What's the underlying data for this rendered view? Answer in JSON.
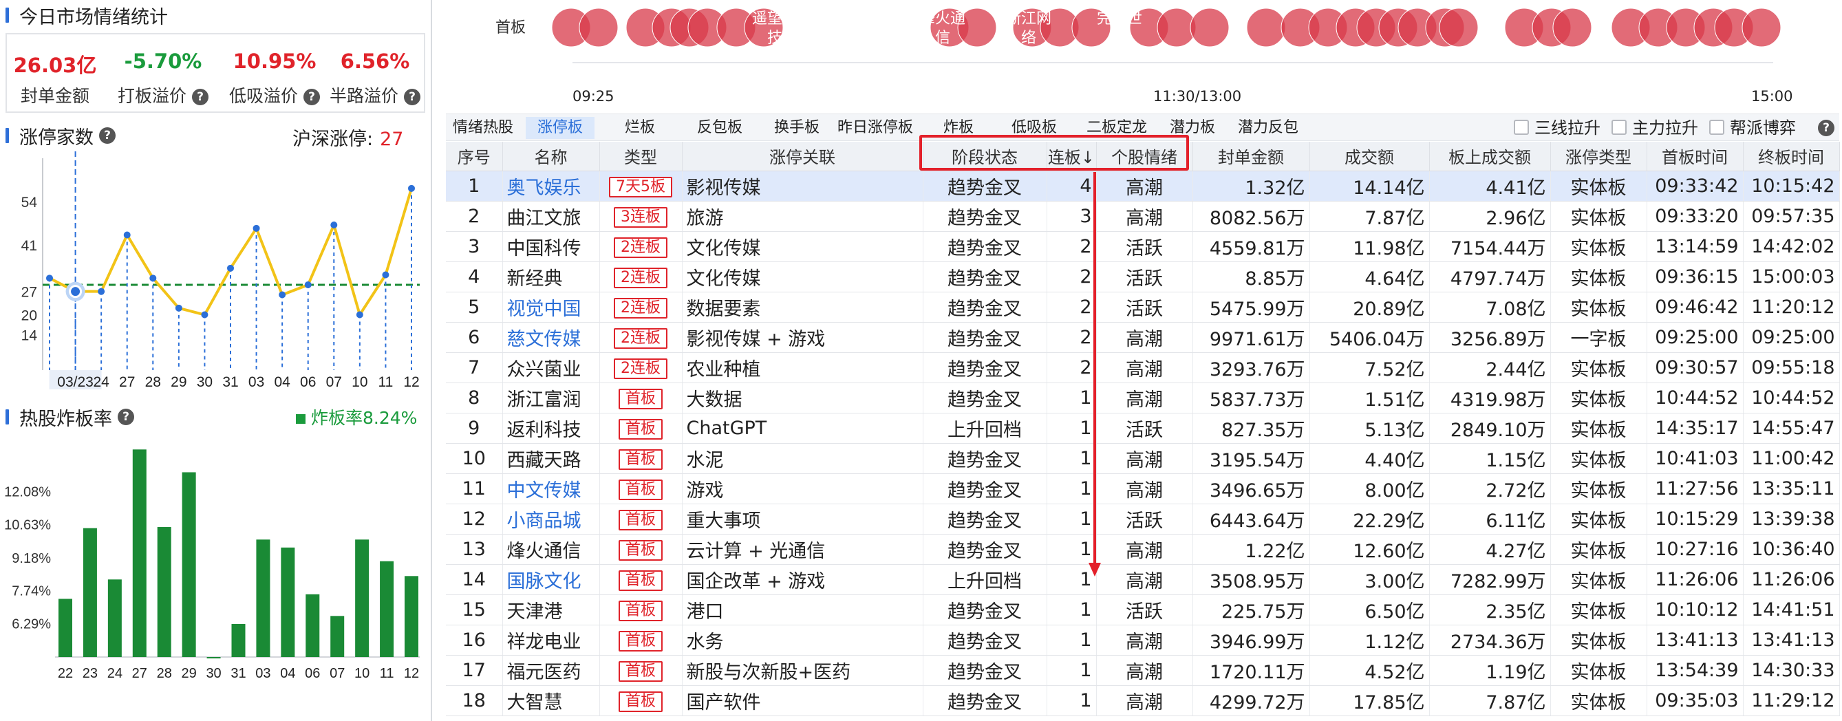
{
  "left": {
    "summary_title": "今日市场情绪统计",
    "stats": [
      {
        "value": "26.03亿",
        "label": "封单金额",
        "color": "red",
        "help": false
      },
      {
        "value": "-5.70%",
        "label": "打板溢价",
        "color": "green",
        "help": true
      },
      {
        "value": "10.95%",
        "label": "低吸溢价",
        "color": "red",
        "help": true
      },
      {
        "value": "6.56%",
        "label": "半路溢价",
        "color": "red",
        "help": true
      }
    ],
    "zt_title": "涨停家数",
    "zt_count_label": "沪深涨停:",
    "zt_count_value": "27",
    "zbl_title": "热股炸板率",
    "zbl_legend": "炸板率8.24%"
  },
  "chart_data": [
    {
      "type": "line",
      "categories": [
        "",
        "03/23",
        "24",
        "27",
        "28",
        "29",
        "30",
        "31",
        "03",
        "04",
        "06",
        "07",
        "10",
        "11",
        "12"
      ],
      "values": [
        31,
        27,
        27,
        44,
        31,
        22,
        20,
        34,
        46,
        26,
        29,
        47,
        20,
        32,
        58
      ],
      "reference_line": 29,
      "highlight_index": 1,
      "yticks": [
        14,
        20,
        27,
        41,
        54
      ],
      "ylim": [
        5,
        65
      ],
      "grid": false,
      "colors": {
        "line": "#f2c317",
        "ref": "#1a8a35",
        "drop": "#2b6fd8"
      }
    },
    {
      "type": "bar",
      "categories": [
        "22",
        "23",
        "24",
        "27",
        "28",
        "29",
        "30",
        "31",
        "03",
        "04",
        "06",
        "07",
        "10",
        "11",
        "12"
      ],
      "values": [
        7.35,
        10.45,
        8.2,
        13.9,
        10.5,
        12.9,
        4.8,
        6.25,
        9.95,
        9.6,
        7.55,
        6.6,
        9.95,
        9.0,
        8.35
      ],
      "yticks": [
        "12.08%",
        "10.63%",
        "9.18%",
        "7.74%",
        "6.29%"
      ],
      "ytick_values": [
        12.08,
        10.63,
        9.18,
        7.74,
        6.29
      ],
      "ylim": [
        4.8,
        14.0
      ],
      "color": "#1a8a35"
    }
  ],
  "timeline": {
    "label": "首板",
    "times": [
      "09:25",
      "11:30/13:00",
      "15:00"
    ],
    "bubble_names": [
      "遥望科技",
      "烽火通信",
      "浙江网络",
      "完美世界"
    ]
  },
  "tabs": [
    "情绪热股",
    "涨停板",
    "烂板",
    "反包板",
    "换手板",
    "昨日涨停板",
    "炸板",
    "低吸板",
    "二板定龙",
    "潜力板",
    "潜力反包"
  ],
  "active_tab": 1,
  "checkboxes": [
    "三线拉升",
    "主力拉升",
    "帮派博弈"
  ],
  "table": {
    "headers": [
      "序号",
      "名称",
      "类型",
      "涨停关联",
      "阶段状态",
      "连板↓",
      "个股情绪",
      "封单金额",
      "成交额",
      "板上成交额",
      "涨停类型",
      "首板时间",
      "终板时间"
    ],
    "rows": [
      [
        "1",
        "奥飞娱乐",
        "7天5板",
        "影视传媒",
        "趋势金叉",
        "4",
        "高潮",
        "1.32亿",
        "14.14亿",
        "4.41亿",
        "实体板",
        "09:33:42",
        "10:15:42"
      ],
      [
        "2",
        "曲江文旅",
        "3连板",
        "旅游",
        "趋势金叉",
        "3",
        "高潮",
        "8082.56万",
        "7.87亿",
        "2.96亿",
        "实体板",
        "09:33:20",
        "09:57:35"
      ],
      [
        "3",
        "中国科传",
        "2连板",
        "文化传媒",
        "趋势金叉",
        "2",
        "活跃",
        "4559.81万",
        "11.98亿",
        "7154.44万",
        "实体板",
        "13:14:59",
        "14:42:02"
      ],
      [
        "4",
        "新经典",
        "2连板",
        "文化传媒",
        "趋势金叉",
        "2",
        "活跃",
        "8.85万",
        "4.64亿",
        "4797.74万",
        "实体板",
        "09:36:15",
        "15:00:03"
      ],
      [
        "5",
        "视觉中国",
        "2连板",
        "数据要素",
        "趋势金叉",
        "2",
        "活跃",
        "5475.99万",
        "20.89亿",
        "7.08亿",
        "实体板",
        "09:46:42",
        "11:20:12"
      ],
      [
        "6",
        "慈文传媒",
        "2连板",
        "影视传媒 + 游戏",
        "趋势金叉",
        "2",
        "高潮",
        "9971.61万",
        "5406.04万",
        "3256.89万",
        "一字板",
        "09:25:00",
        "09:25:00"
      ],
      [
        "7",
        "众兴菌业",
        "2连板",
        "农业种植",
        "趋势金叉",
        "2",
        "高潮",
        "3293.76万",
        "7.52亿",
        "2.44亿",
        "实体板",
        "09:30:57",
        "09:55:18"
      ],
      [
        "8",
        "浙江富润",
        "首板",
        "大数据",
        "趋势金叉",
        "1",
        "高潮",
        "5837.73万",
        "1.51亿",
        "4319.98万",
        "实体板",
        "10:44:52",
        "10:44:52"
      ],
      [
        "9",
        "返利科技",
        "首板",
        "ChatGPT",
        "上升回档",
        "1",
        "活跃",
        "827.35万",
        "5.13亿",
        "2849.10万",
        "实体板",
        "14:35:17",
        "14:55:47"
      ],
      [
        "10",
        "西藏天路",
        "首板",
        "水泥",
        "趋势金叉",
        "1",
        "高潮",
        "3195.54万",
        "4.40亿",
        "1.15亿",
        "实体板",
        "10:41:03",
        "11:00:42"
      ],
      [
        "11",
        "中文传媒",
        "首板",
        "游戏",
        "趋势金叉",
        "1",
        "高潮",
        "3496.65万",
        "8.00亿",
        "2.72亿",
        "实体板",
        "11:27:56",
        "13:35:11"
      ],
      [
        "12",
        "小商品城",
        "首板",
        "重大事项",
        "趋势金叉",
        "1",
        "活跃",
        "6443.64万",
        "22.29亿",
        "6.11亿",
        "实体板",
        "10:15:29",
        "13:39:38"
      ],
      [
        "13",
        "烽火通信",
        "首板",
        "云计算 + 光通信",
        "趋势金叉",
        "1",
        "高潮",
        "1.22亿",
        "12.60亿",
        "4.27亿",
        "实体板",
        "10:27:16",
        "10:36:40"
      ],
      [
        "14",
        "国脉文化",
        "首板",
        "国企改革 + 游戏",
        "上升回档",
        "1",
        "高潮",
        "3508.95万",
        "3.00亿",
        "7282.99万",
        "实体板",
        "11:26:06",
        "11:26:06"
      ],
      [
        "15",
        "天津港",
        "首板",
        "港口",
        "趋势金叉",
        "1",
        "活跃",
        "225.75万",
        "6.50亿",
        "2.35亿",
        "实体板",
        "10:10:12",
        "14:41:51"
      ],
      [
        "16",
        "祥龙电业",
        "首板",
        "水务",
        "趋势金叉",
        "1",
        "高潮",
        "3946.99万",
        "1.12亿",
        "2734.36万",
        "实体板",
        "13:41:13",
        "13:41:13"
      ],
      [
        "17",
        "福元医药",
        "首板",
        "新股与次新股+医药",
        "趋势金叉",
        "1",
        "高潮",
        "1720.11万",
        "4.52亿",
        "1.19亿",
        "实体板",
        "13:54:39",
        "14:30:33"
      ],
      [
        "18",
        "大智慧",
        "首板",
        "国产软件",
        "趋势金叉",
        "1",
        "高潮",
        "4299.72万",
        "17.85亿",
        "7.87亿",
        "实体板",
        "09:35:03",
        "11:29:12"
      ]
    ],
    "blue_names": [
      "奥飞娱乐",
      "视觉中国",
      "慈文传媒",
      "中文传媒",
      "小商品城",
      "国脉文化"
    ],
    "selected_row": 0
  },
  "colors": {
    "red": "#e0232a",
    "green": "#1a9b3c",
    "blue": "#2b6fd8",
    "bubble": "#d8394a"
  }
}
